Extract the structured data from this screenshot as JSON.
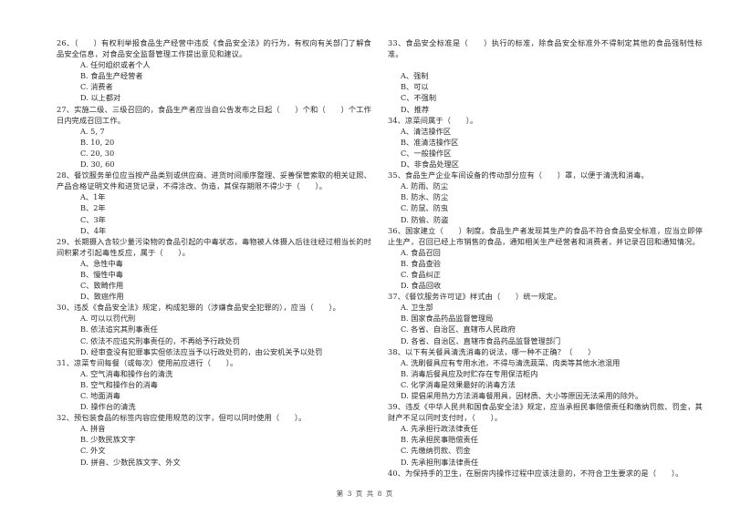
{
  "page": {
    "footer": "第 3 页 共 8 页"
  },
  "left_column": [
    {
      "number": "26",
      "stem": "26、（　　）有权利举报食品生产经营中违反《食品安全法》的行为，有权向有关部门了解食品安全信息，对食品安全监督管理工作提出意见和建议。",
      "options": [
        "A. 任何组织或者个人",
        "B. 食品生产经营者",
        "C. 消费者",
        "D. 以上都对"
      ]
    },
    {
      "number": "27",
      "stem": "27、实施二级、三级召回的，食品生产者应当自公告发布之日起（　　）个和（　　）个工作日内完成召回工作。",
      "options": [
        "A. 5, 7",
        "B. 10, 20",
        "C. 20, 30",
        "D. 30, 60"
      ]
    },
    {
      "number": "28",
      "stem": "28、餐饮服务单位应当按产品类别或供应商、进货时间顺序整理、妥善保管索取的相关证照、产品合格证明文件和进货记录，不得涂改、伪造，其保存期限不得少于（　　）。",
      "options": [
        "A、1年",
        "B、2年",
        "C、3年",
        "D、4年"
      ]
    },
    {
      "number": "29",
      "stem": "29、长期摄入含较少量污染物的食品引起的中毒状态，毒物被人体摄入后往往经过相当长的时间积累才引起毒性反应，属于（　　）。",
      "options": [
        "A、急性中毒",
        "B、慢性中毒",
        "C、致畸作用",
        "D、致癌作用"
      ]
    },
    {
      "number": "30",
      "stem": "30、违反《食品安全法》规定，构成犯罪的（涉嫌食品安全犯罪的），应当（　　）。",
      "options": [
        "A. 可以以罚代刑",
        "B. 依法追究其刑事责任",
        "C. 依法不应追究刑事责任的，不再给予行政处罚",
        "D. 经审查没有犯罪事实但依法应当予以行政处罚的，由公安机关予以处罚"
      ]
    },
    {
      "number": "31",
      "stem": "31、凉菜专间每餐（或每次）使用前应进行（　　）。",
      "options": [
        "A. 空气消毒和操作台的清洗",
        "B. 空气和操作台的消毒",
        "C. 地面消毒",
        "D. 操作台的清洗"
      ]
    },
    {
      "number": "32",
      "stem": "32、预包装食品的标签内容应使用规范的汉字，但可以同时使用（　　）。",
      "options": [
        "A. 拼音",
        "B. 少数民族文字",
        "C. 外文",
        "D. 拼音、少数民族文字、外文"
      ]
    }
  ],
  "right_column": [
    {
      "number": "33",
      "stem": "33、食品安全标准是（　　）执行的标准，除食品安全标准外不得制定其他的食品强制性标准。",
      "gap_after_stem": true,
      "options": [
        "A、强制",
        "B、可以",
        "C、不强制",
        "D、推荐"
      ]
    },
    {
      "number": "34",
      "stem": "34、凉菜间属于（　　）。",
      "options": [
        "A、清洁操作区",
        "B、准清洁操作区",
        "C、一般操作区",
        "D、非食品处理区"
      ]
    },
    {
      "number": "35",
      "stem": "35、食品生产企业车间设备的传动部分应有（　　）罩，以便于清洗和消毒。",
      "options": [
        "A. 防雨、防尘",
        "B. 防水、防尘",
        "C. 防鼠、防虫",
        "D. 防偷、防盗"
      ]
    },
    {
      "number": "36",
      "stem": "36、国家建立（　　）制度。食品生产者发现其生产的食品不符合食品安全标准，应当立即停止生产，召回已经上市销售的食品，通知相关生产经营者和消费者，并记录召回和通知情况。",
      "options": [
        "A. 食品召回",
        "B. 食品查验",
        "C. 食品纠正",
        "D. 食品回收"
      ]
    },
    {
      "number": "37",
      "stem": "37、《餐饮服务许可证》样式由（　　）统一规定。",
      "options": [
        "A. 卫生部",
        "B. 国家食品药品监督管理局",
        "C. 各省、自治区、直辖市人民政府",
        "D. 各省、自治区、直辖市食品药品监督管理部门"
      ]
    },
    {
      "number": "38",
      "stem": "38、以下有关餐具清洗消毒的说法，哪一种不正确？（　　）",
      "options": [
        "A. 洗刷餐具应有专用水池，不得与清洗蔬菜、肉类等其他水池混用",
        "B. 消毒后餐具应及时贮存在专用保洁柜内",
        "C. 化学消毒是效果最好的消毒方法",
        "D. 提倡采用热力方法消毒餐用具，因材质、大小等原因无法采用的除外。"
      ]
    },
    {
      "number": "39",
      "stem": "39、违反《中华人民共和国食品安全法》规定，应当承担民事赔偿责任和缴纳罚款、罚金，其财产不足以同时支付时，（　　）。",
      "options": [
        "A. 先承担行政法律责任",
        "B. 先承担民事赔偿责任",
        "C. 先缴纳罚款、罚金",
        "D. 先承担刑事法律责任"
      ]
    },
    {
      "number": "40",
      "stem": "40、为保持手的卫生，在厨房内操作过程中应该注意的，不符合卫生要求的是（　　）。",
      "options": []
    }
  ]
}
